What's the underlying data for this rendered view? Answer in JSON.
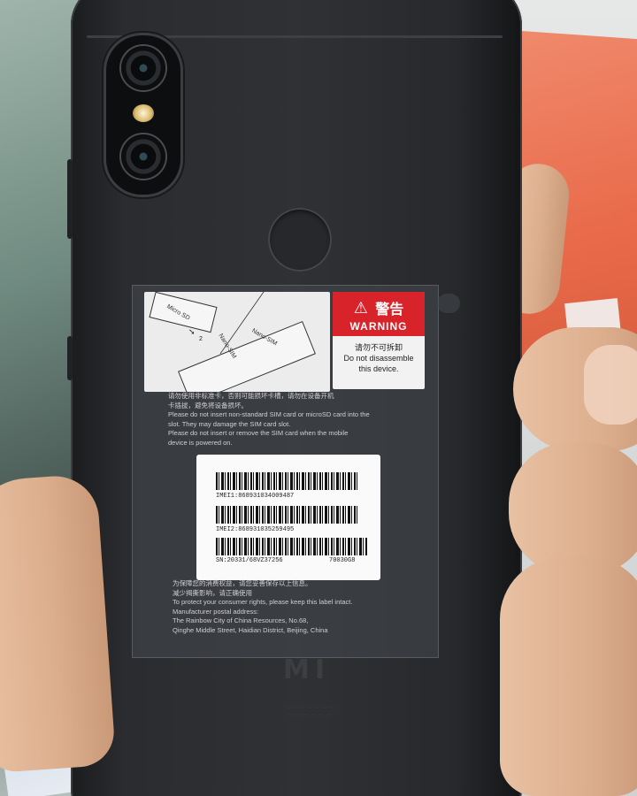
{
  "sim_diagram": {
    "labels": [
      "Micro SD",
      "Nano-SIM",
      "Nano-SIM"
    ],
    "slot_label": "2"
  },
  "warning": {
    "symbol": "⚠",
    "title_cn": "警告",
    "title_en": "WARNING",
    "note_cn": "请勿不可拆卸",
    "note_en_line1": "Do not disassemble",
    "note_en_line2": "this device."
  },
  "notice": {
    "cn_line1": "请勿使用非标准卡，否则可能损坏卡槽，请勿在设备开机",
    "cn_line2": "卡插拔，避免将设备损坏。",
    "en_line1": "Please do not insert non-standard SIM card or microSD card into the",
    "en_line2": "slot. They may damage the SIM card slot.",
    "en_line3": "Please do not insert or remove the SIM card when the mobile",
    "en_line4": "device is powered on."
  },
  "barcode_label": {
    "imei1": "IMEI1:868931034009487",
    "imei2": "IMEI2:868931035259495",
    "sn": "SN:20331/68VZ37256",
    "model": "70030G8"
  },
  "footer_notice": {
    "cn_line1": "为保障您的消费权益，请您妥善保存以上信息。",
    "cn_line2": "减少揭撕影响，请正确使用",
    "en_line1": "To protect your consumer rights, please keep this label intact.",
    "en_line2": "Manufacturer postal address:",
    "en_line3": "The Rainbow City of China Resources, No.68,",
    "en_line4": "Qinghe Middle Street, Haidian District, Beijing, China"
  },
  "logo": "MI"
}
